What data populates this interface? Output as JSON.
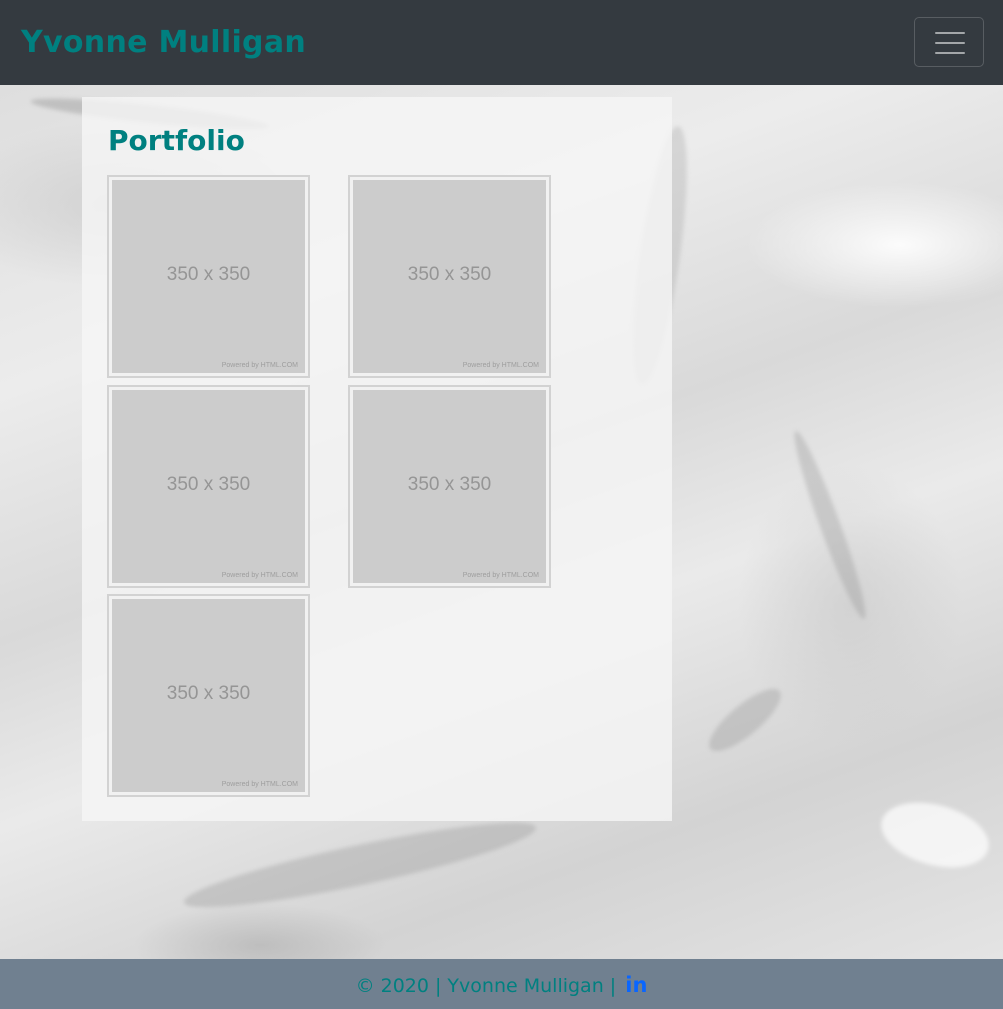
{
  "navbar": {
    "brand": "Yvonne Mulligan",
    "toggler_icon": "hamburger-menu-icon"
  },
  "main": {
    "title": "Portfolio",
    "thumbnails": [
      {
        "size_label": "350 x 350",
        "powered_label": "Powered by HTML.COM"
      },
      {
        "size_label": "350 x 350",
        "powered_label": "Powered by HTML.COM"
      },
      {
        "size_label": "350 x 350",
        "powered_label": "Powered by HTML.COM"
      },
      {
        "size_label": "350 x 350",
        "powered_label": "Powered by HTML.COM"
      },
      {
        "size_label": "350 x 350",
        "powered_label": "Powered by HTML.COM"
      }
    ]
  },
  "footer": {
    "text": "© 2020 | Yvonne Mulligan |",
    "linkedin_label": "in",
    "linkedin_icon": "linkedin-icon"
  },
  "colors": {
    "navbar_bg": "#343a40",
    "brand": "#008080",
    "footer_bg": "#708090",
    "linkedin": "#0a66ff",
    "placeholder": "#cccccc"
  }
}
